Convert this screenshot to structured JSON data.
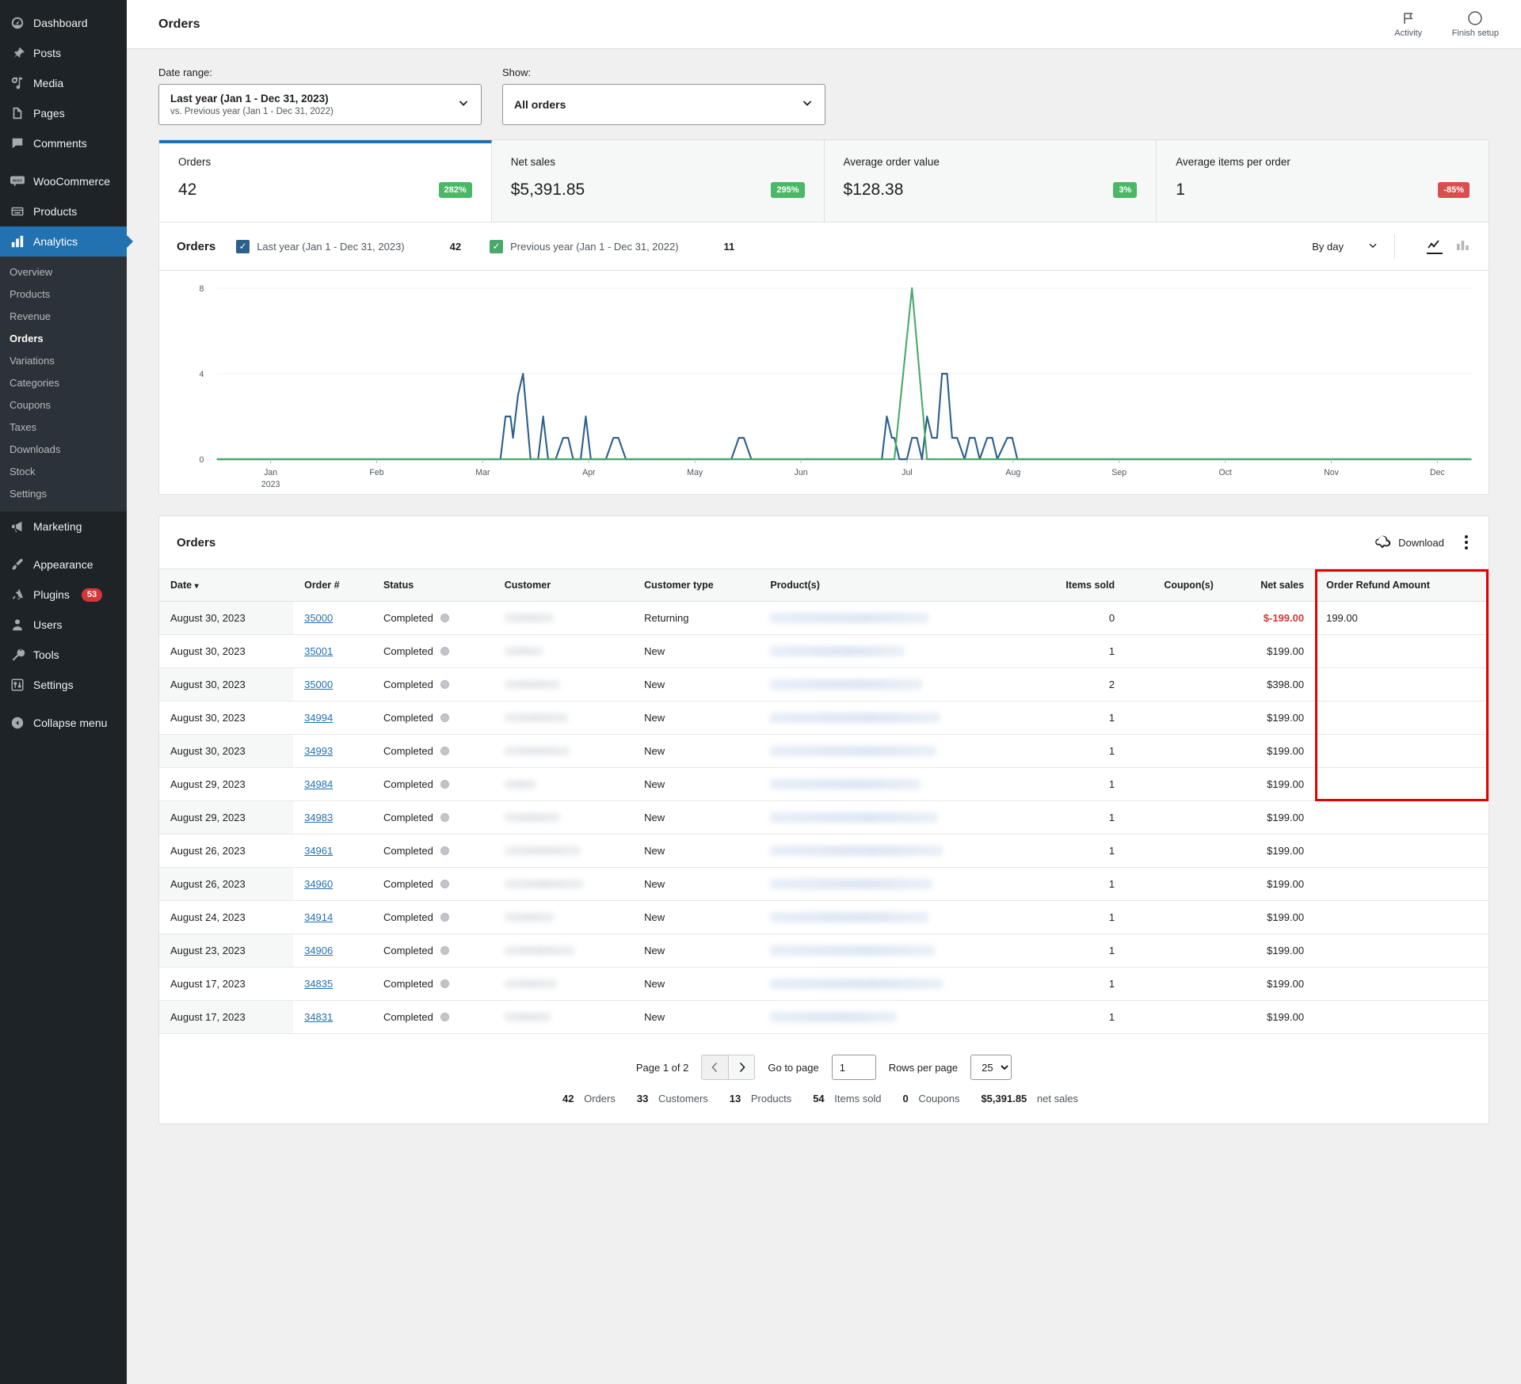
{
  "sidebar": {
    "top_items": [
      {
        "label": "Dashboard",
        "icon": "dashboard-icon"
      },
      {
        "label": "Posts",
        "icon": "pin-icon"
      },
      {
        "label": "Media",
        "icon": "media-icon"
      },
      {
        "label": "Pages",
        "icon": "pages-icon"
      },
      {
        "label": "Comments",
        "icon": "comment-icon"
      }
    ],
    "plugin_items": [
      {
        "label": "WooCommerce",
        "icon": "woocommerce-icon"
      },
      {
        "label": "Products",
        "icon": "products-icon"
      },
      {
        "label": "Analytics",
        "icon": "analytics-icon",
        "active": true
      }
    ],
    "analytics_submenu": [
      {
        "label": "Overview"
      },
      {
        "label": "Products"
      },
      {
        "label": "Revenue"
      },
      {
        "label": "Orders",
        "current": true
      },
      {
        "label": "Variations"
      },
      {
        "label": "Categories"
      },
      {
        "label": "Coupons"
      },
      {
        "label": "Taxes"
      },
      {
        "label": "Downloads"
      },
      {
        "label": "Stock"
      },
      {
        "label": "Settings"
      }
    ],
    "marketing": {
      "label": "Marketing",
      "icon": "megaphone-icon"
    },
    "bottom_items": [
      {
        "label": "Appearance",
        "icon": "brush-icon"
      },
      {
        "label": "Plugins",
        "icon": "plug-icon",
        "badge": "53"
      },
      {
        "label": "Users",
        "icon": "user-icon"
      },
      {
        "label": "Tools",
        "icon": "wrench-icon"
      },
      {
        "label": "Settings",
        "icon": "sliders-icon"
      }
    ],
    "collapse": {
      "label": "Collapse menu",
      "icon": "collapse-icon"
    }
  },
  "topbar": {
    "title": "Orders",
    "activity_label": "Activity",
    "finish_setup_label": "Finish setup"
  },
  "filters": {
    "date_range_label": "Date range:",
    "date_range_value": "Last year (Jan 1 - Dec 31, 2023)",
    "date_range_compare": "vs. Previous year (Jan 1 - Dec 31, 2022)",
    "show_label": "Show:",
    "show_value": "All orders"
  },
  "summary_cards": [
    {
      "title": "Orders",
      "value": "42",
      "delta": "282%",
      "direction": "up",
      "active": true
    },
    {
      "title": "Net sales",
      "value": "$5,391.85",
      "delta": "295%",
      "direction": "up",
      "active": false
    },
    {
      "title": "Average order value",
      "value": "$128.38",
      "delta": "3%",
      "direction": "up",
      "active": false
    },
    {
      "title": "Average items per order",
      "value": "1",
      "delta": "-85%",
      "direction": "down",
      "active": false
    }
  ],
  "chart": {
    "title": "Orders",
    "legend": [
      {
        "label": "Last year (Jan 1 - Dec 31, 2023)",
        "total": "42",
        "color": "#2c5f8a",
        "checked": true
      },
      {
        "label": "Previous year (Jan 1 - Dec 31, 2022)",
        "total": "11",
        "color": "#4aa86a",
        "checked": true
      }
    ],
    "interval_label": "By day",
    "line_chart_icon": "line-chart-icon",
    "bar_chart_icon": "bar-chart-icon"
  },
  "chart_data": {
    "type": "line",
    "title": "Orders",
    "xlabel": "",
    "ylabel": "",
    "ylim": [
      0,
      8
    ],
    "yticks": [
      0,
      4,
      8
    ],
    "grid": true,
    "legend_position": "top",
    "xticks": [
      "Jan\n2023",
      "Feb",
      "Mar",
      "Apr",
      "May",
      "Jun",
      "Jul",
      "Aug",
      "Sep",
      "Oct",
      "Nov",
      "Dec"
    ],
    "series": [
      {
        "name": "Last year (Jan 1 - Dec 31, 2023)",
        "color": "#2c5f8a",
        "total": 42,
        "points": [
          [
            0.0,
            0
          ],
          [
            22.0,
            0
          ],
          [
            22.6,
            0
          ],
          [
            23.0,
            2
          ],
          [
            23.4,
            2
          ],
          [
            23.6,
            1
          ],
          [
            24.0,
            3
          ],
          [
            24.4,
            4
          ],
          [
            25.0,
            0
          ],
          [
            25.6,
            0
          ],
          [
            26.0,
            2
          ],
          [
            26.4,
            0
          ],
          [
            27.0,
            0
          ],
          [
            27.6,
            1
          ],
          [
            28.0,
            1
          ],
          [
            28.4,
            0
          ],
          [
            29.0,
            0
          ],
          [
            29.4,
            2
          ],
          [
            29.8,
            0
          ],
          [
            31.0,
            0
          ],
          [
            31.6,
            1
          ],
          [
            32.0,
            1
          ],
          [
            32.6,
            0
          ],
          [
            41.0,
            0
          ],
          [
            41.6,
            1
          ],
          [
            42.0,
            1
          ],
          [
            42.6,
            0
          ],
          [
            53.0,
            0
          ],
          [
            53.4,
            2
          ],
          [
            53.8,
            1
          ],
          [
            54.0,
            1
          ],
          [
            54.4,
            0
          ],
          [
            55.0,
            0
          ],
          [
            55.4,
            1
          ],
          [
            55.8,
            1
          ],
          [
            56.2,
            0
          ],
          [
            56.6,
            2
          ],
          [
            57.0,
            1
          ],
          [
            57.4,
            1
          ],
          [
            57.8,
            4
          ],
          [
            58.2,
            4
          ],
          [
            58.6,
            1
          ],
          [
            59.0,
            1
          ],
          [
            59.6,
            0
          ],
          [
            60.0,
            1
          ],
          [
            60.4,
            1
          ],
          [
            60.8,
            0
          ],
          [
            61.4,
            1
          ],
          [
            61.8,
            1
          ],
          [
            62.2,
            0
          ],
          [
            63.0,
            1
          ],
          [
            63.4,
            1
          ],
          [
            63.8,
            0
          ],
          [
            100,
            0
          ]
        ]
      },
      {
        "name": "Previous year (Jan 1 - Dec 31, 2022)",
        "color": "#4aa86a",
        "total": 11,
        "points": [
          [
            0,
            0
          ],
          [
            54.0,
            0
          ],
          [
            55.4,
            8
          ],
          [
            56.6,
            0
          ],
          [
            100,
            0
          ]
        ]
      }
    ]
  },
  "table": {
    "title": "Orders",
    "download_label": "Download",
    "menu_icon": "kebab-menu-icon",
    "columns": [
      {
        "key": "date",
        "label": "Date",
        "sorted": true,
        "align": "left"
      },
      {
        "key": "order",
        "label": "Order #",
        "align": "left"
      },
      {
        "key": "status",
        "label": "Status",
        "align": "left"
      },
      {
        "key": "customer",
        "label": "Customer",
        "align": "left"
      },
      {
        "key": "customer_type",
        "label": "Customer type",
        "align": "left"
      },
      {
        "key": "products",
        "label": "Product(s)",
        "align": "left"
      },
      {
        "key": "items_sold",
        "label": "Items sold",
        "align": "right"
      },
      {
        "key": "coupons",
        "label": "Coupon(s)",
        "align": "right"
      },
      {
        "key": "net_sales",
        "label": "Net sales",
        "align": "right"
      },
      {
        "key": "refund",
        "label": "Order Refund Amount",
        "align": "left"
      }
    ],
    "rows": [
      {
        "date": "August 30, 2023",
        "order": "35000",
        "status": "Completed",
        "customer_type": "Returning",
        "items_sold": "0",
        "coupons": "",
        "net_sales": "$-199.00",
        "net_negative": true,
        "refund": "199.00"
      },
      {
        "date": "August 30, 2023",
        "order": "35001",
        "status": "Completed",
        "customer_type": "New",
        "items_sold": "1",
        "coupons": "",
        "net_sales": "$199.00",
        "net_negative": false,
        "refund": ""
      },
      {
        "date": "August 30, 2023",
        "order": "35000",
        "status": "Completed",
        "customer_type": "New",
        "items_sold": "2",
        "coupons": "",
        "net_sales": "$398.00",
        "net_negative": false,
        "refund": ""
      },
      {
        "date": "August 30, 2023",
        "order": "34994",
        "status": "Completed",
        "customer_type": "New",
        "items_sold": "1",
        "coupons": "",
        "net_sales": "$199.00",
        "net_negative": false,
        "refund": ""
      },
      {
        "date": "August 30, 2023",
        "order": "34993",
        "status": "Completed",
        "customer_type": "New",
        "items_sold": "1",
        "coupons": "",
        "net_sales": "$199.00",
        "net_negative": false,
        "refund": ""
      },
      {
        "date": "August 29, 2023",
        "order": "34984",
        "status": "Completed",
        "customer_type": "New",
        "items_sold": "1",
        "coupons": "",
        "net_sales": "$199.00",
        "net_negative": false,
        "refund": ""
      },
      {
        "date": "August 29, 2023",
        "order": "34983",
        "status": "Completed",
        "customer_type": "New",
        "items_sold": "1",
        "coupons": "",
        "net_sales": "$199.00",
        "net_negative": false,
        "refund": ""
      },
      {
        "date": "August 26, 2023",
        "order": "34961",
        "status": "Completed",
        "customer_type": "New",
        "items_sold": "1",
        "coupons": "",
        "net_sales": "$199.00",
        "net_negative": false,
        "refund": ""
      },
      {
        "date": "August 26, 2023",
        "order": "34960",
        "status": "Completed",
        "customer_type": "New",
        "items_sold": "1",
        "coupons": "",
        "net_sales": "$199.00",
        "net_negative": false,
        "refund": ""
      },
      {
        "date": "August 24, 2023",
        "order": "34914",
        "status": "Completed",
        "customer_type": "New",
        "items_sold": "1",
        "coupons": "",
        "net_sales": "$199.00",
        "net_negative": false,
        "refund": ""
      },
      {
        "date": "August 23, 2023",
        "order": "34906",
        "status": "Completed",
        "customer_type": "New",
        "items_sold": "1",
        "coupons": "",
        "net_sales": "$199.00",
        "net_negative": false,
        "refund": ""
      },
      {
        "date": "August 17, 2023",
        "order": "34835",
        "status": "Completed",
        "customer_type": "New",
        "items_sold": "1",
        "coupons": "",
        "net_sales": "$199.00",
        "net_negative": false,
        "refund": ""
      },
      {
        "date": "August 17, 2023",
        "order": "34831",
        "status": "Completed",
        "customer_type": "New",
        "items_sold": "1",
        "coupons": "",
        "net_sales": "$199.00",
        "net_negative": false,
        "refund": ""
      }
    ]
  },
  "pagination": {
    "page_text": "Page 1 of 2",
    "prev_icon": "chevron-left-icon",
    "next_icon": "chevron-right-icon",
    "goto_label": "Go to page",
    "goto_value": "1",
    "rows_label": "Rows per page",
    "rows_value": "25"
  },
  "footer_summary": [
    {
      "num": "42",
      "label": "Orders"
    },
    {
      "num": "33",
      "label": "Customers"
    },
    {
      "num": "13",
      "label": "Products"
    },
    {
      "num": "54",
      "label": "Items sold"
    },
    {
      "num": "0",
      "label": "Coupons"
    },
    {
      "num": "$5,391.85",
      "label": "net sales"
    }
  ],
  "colors": {
    "accent": "#2271b1",
    "series_current": "#2c5f8a",
    "series_previous": "#4aa86a",
    "positive": "#4ab866",
    "negative": "#d94f4f",
    "annotation": "#e50000"
  }
}
